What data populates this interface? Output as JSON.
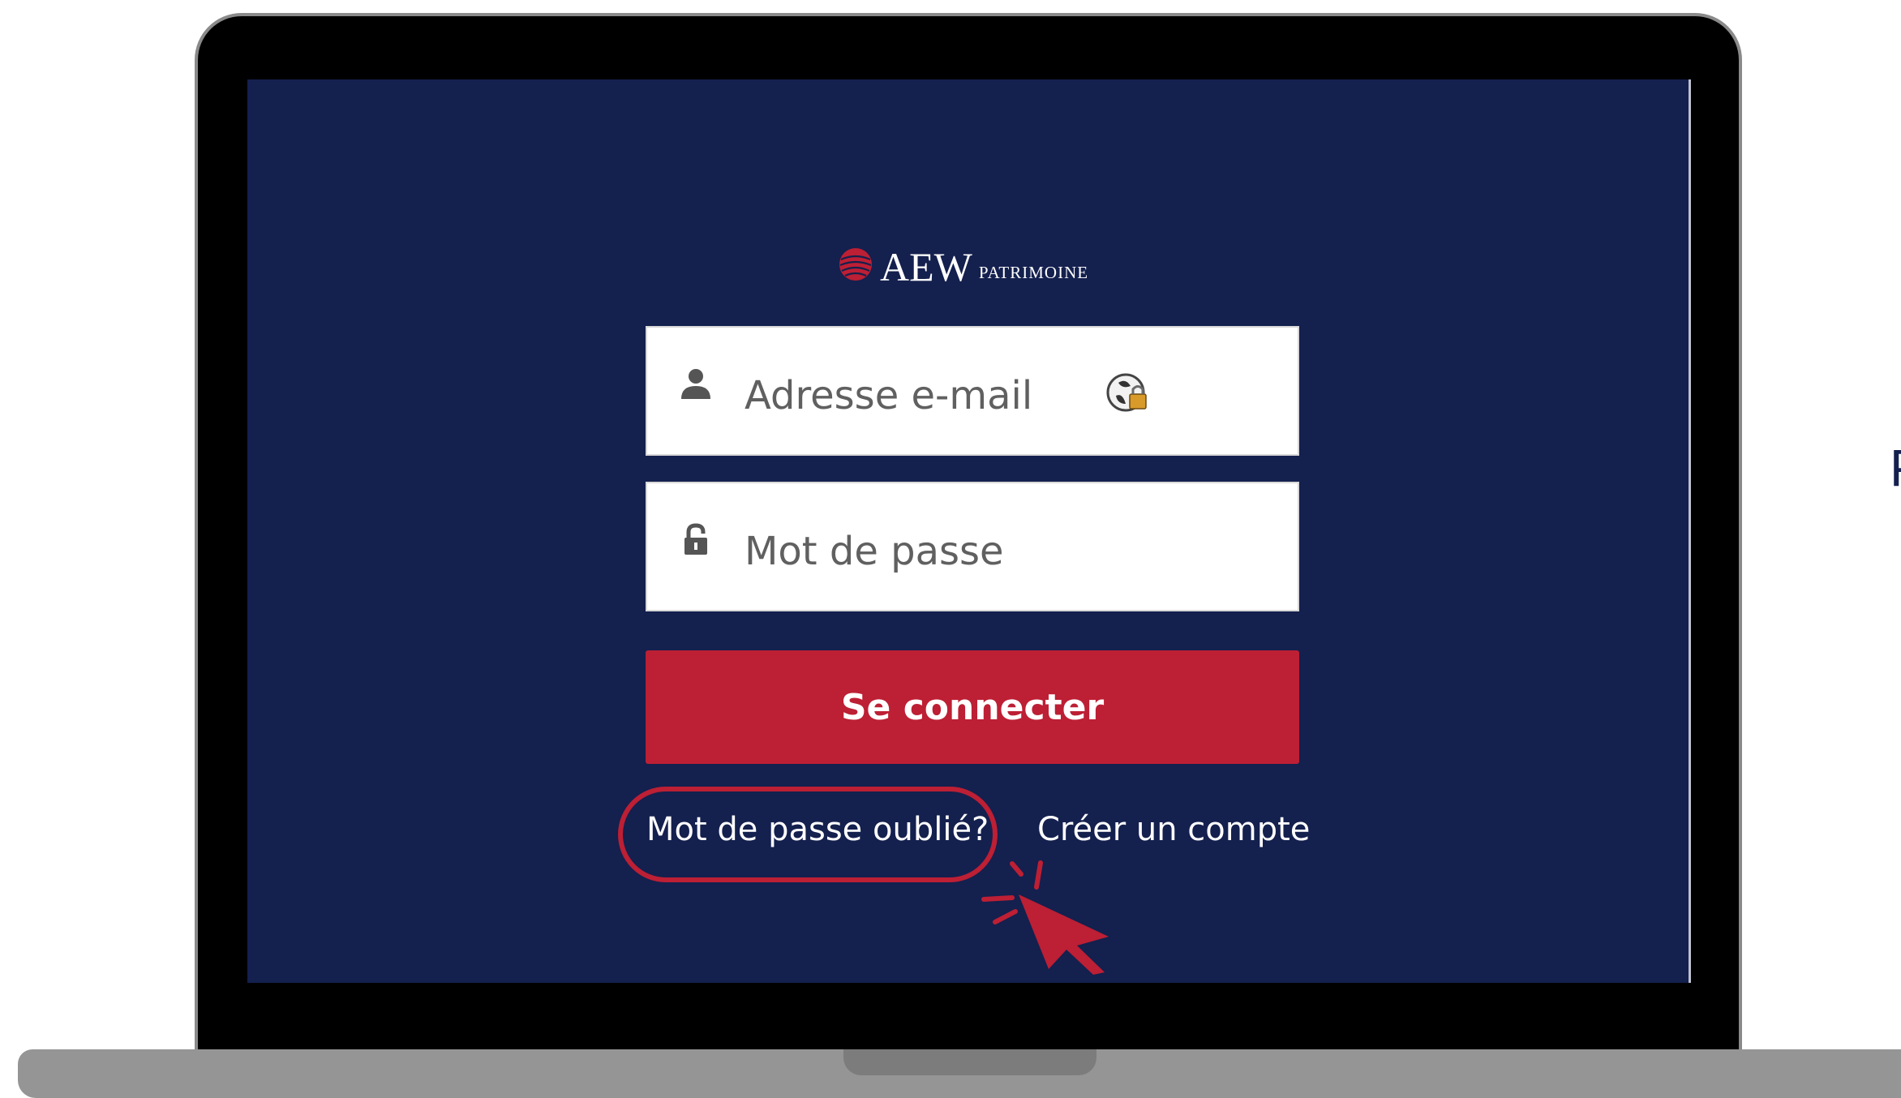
{
  "brand": {
    "main": "AEW",
    "sub": "PATRIMOINE"
  },
  "form": {
    "email_placeholder": "Adresse e-mail",
    "password_placeholder": "Mot de passe",
    "submit_label": "Se connecter"
  },
  "links": {
    "forgot_password": "Mot de passe oublié?",
    "create_account": "Créer un compte"
  },
  "edge_text": "P",
  "colors": {
    "screen_bg": "#14204e",
    "accent": "#bd1f34"
  }
}
